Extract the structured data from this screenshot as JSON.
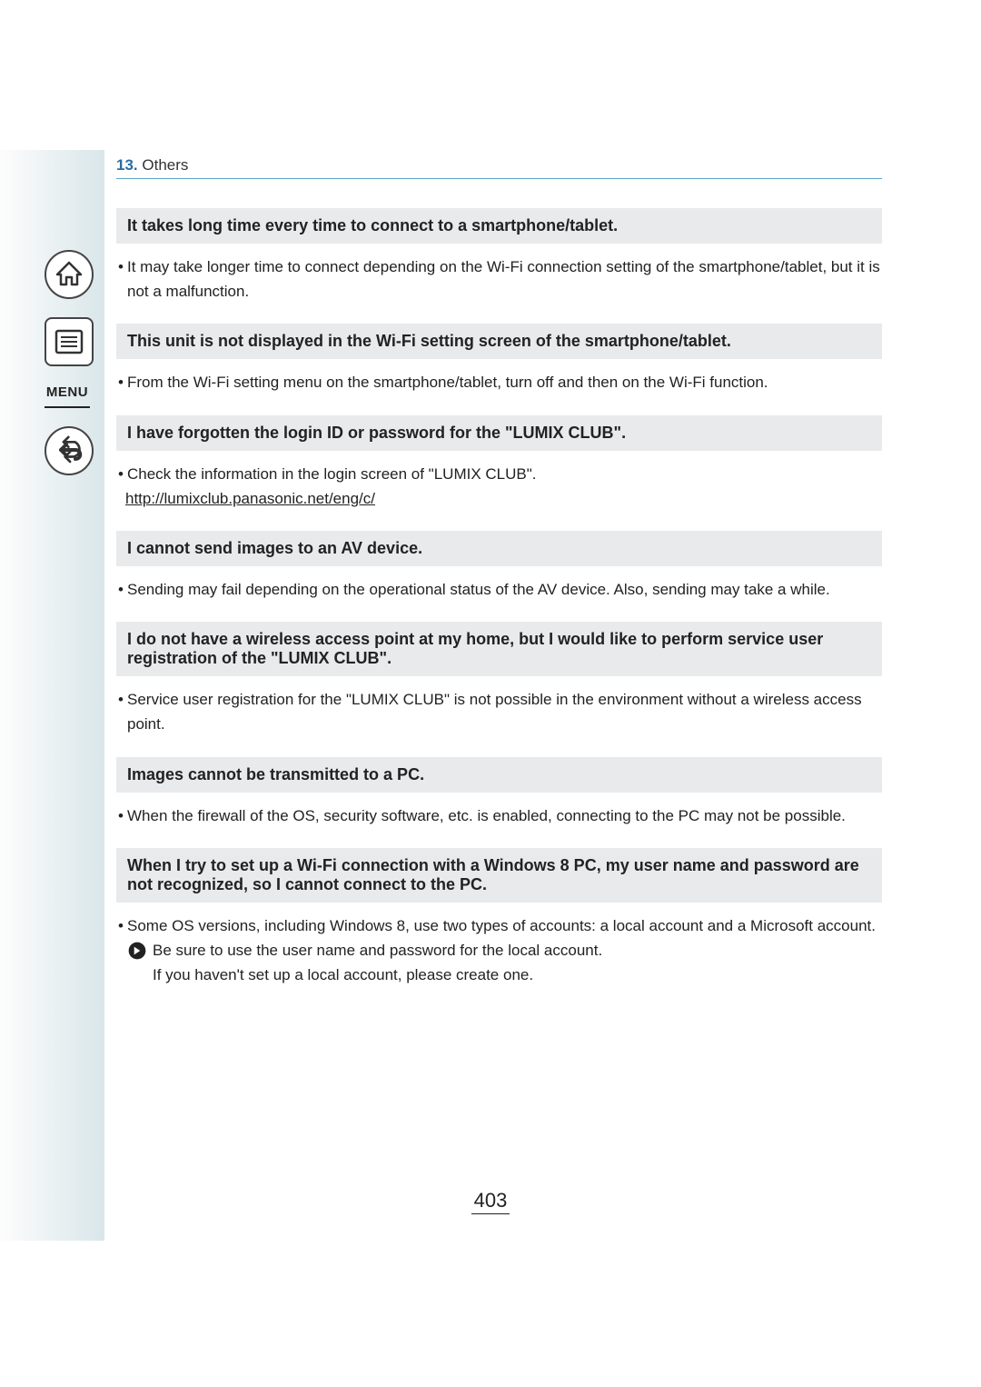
{
  "breadcrumb": {
    "num": "13.",
    "label": "Others"
  },
  "nav": {
    "menu_label": "MENU"
  },
  "qa": [
    {
      "q": "It takes long time every time to connect to a smartphone/tablet.",
      "answers": [
        {
          "type": "bullet",
          "text": "It may take longer time to connect depending on the Wi-Fi connection setting of the smartphone/tablet, but it is not a malfunction."
        }
      ]
    },
    {
      "q": "This unit is not displayed in the Wi-Fi setting screen of the smartphone/tablet.",
      "answers": [
        {
          "type": "bullet",
          "text": "From the Wi-Fi setting menu on the smartphone/tablet, turn off and then on the Wi-Fi function."
        }
      ]
    },
    {
      "q": "I have forgotten the login ID or password for the \"LUMIX CLUB\".",
      "answers": [
        {
          "type": "bullet",
          "text": "Check the information in the login screen of \"LUMIX CLUB\"."
        },
        {
          "type": "link",
          "text": "http://lumixclub.panasonic.net/eng/c/"
        }
      ]
    },
    {
      "q": "I cannot send images to an AV device.",
      "answers": [
        {
          "type": "bullet",
          "text": "Sending may fail depending on the operational status of the AV device. Also, sending may take a while."
        }
      ]
    },
    {
      "q": "I do not have a wireless access point at my home, but I would like to perform service user registration of the \"LUMIX CLUB\".",
      "answers": [
        {
          "type": "bullet",
          "text": "Service user registration for the \"LUMIX CLUB\" is not possible in the environment without a wireless access point."
        }
      ]
    },
    {
      "q": "Images cannot be transmitted to a PC.",
      "answers": [
        {
          "type": "bullet",
          "text": "When the firewall of the OS, security software, etc. is enabled, connecting to the PC may not be possible."
        }
      ]
    },
    {
      "q": "When I try to set up a Wi-Fi connection with a Windows 8 PC, my user name and password are not recognized, so I cannot connect to the PC.",
      "answers": [
        {
          "type": "bullet",
          "text": "Some OS versions, including Windows 8, use two types of accounts: a local account and a Microsoft account."
        },
        {
          "type": "sub",
          "text": "Be sure to use the user name and password for the local account."
        },
        {
          "type": "subplain",
          "text": "If you haven't set up a local account, please create one."
        }
      ]
    }
  ],
  "page_number": "403"
}
